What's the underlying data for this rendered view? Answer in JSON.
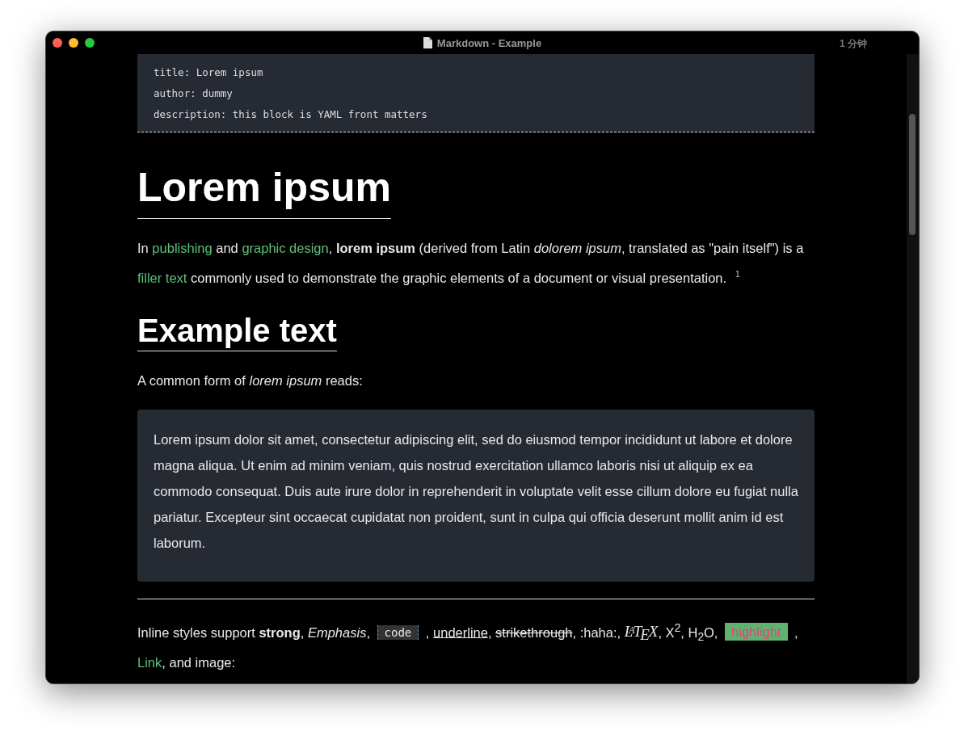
{
  "window": {
    "title": "Markdown - Example",
    "reading_time": "1 分钟"
  },
  "front_matter": [
    "title: Lorem ipsum",
    "author: dummy",
    "description: this block is YAML front matters"
  ],
  "blocks": [
    {
      "kind": "h1",
      "text": "Lorem ipsum"
    },
    {
      "kind": "p",
      "segments": [
        {
          "kind": "plain",
          "text": "In "
        },
        {
          "kind": "link",
          "text": "publishing"
        },
        {
          "kind": "plain",
          "text": " and "
        },
        {
          "kind": "link",
          "text": "graphic design"
        },
        {
          "kind": "plain",
          "text": ", **lorem ipsum** (derived from Latin *dolorem ipsum*, translated as \"pain itself\") is a "
        },
        {
          "kind": "link",
          "text": "filler text"
        },
        {
          "kind": "plain",
          "text": " commonly used to demonstrate the graphic elements of a document or visual presentation. "
        },
        {
          "kind": "footnote",
          "text": "1"
        }
      ]
    },
    {
      "kind": "h2",
      "text": "Example text"
    },
    {
      "kind": "p",
      "segments": [
        {
          "kind": "plain",
          "text": "A common form of *lorem ipsum* reads:"
        }
      ]
    },
    {
      "kind": "quote",
      "text": "Lorem ipsum dolor sit amet, consectetur adipiscing elit, sed do eiusmod tempor incididunt ut labore et dolore magna aliqua. Ut enim ad minim veniam, quis nostrud exercitation ullamco laboris nisi ut aliquip ex ea commodo consequat. Duis aute irure dolor in reprehenderit in voluptate velit esse cillum dolore eu fugiat nulla pariatur. Excepteur sint occaecat cupidatat non proident, sunt in culpa qui officia deserunt mollit anim id est laborum."
    },
    {
      "kind": "hr"
    },
    {
      "kind": "p",
      "segments": [
        {
          "kind": "plain",
          "text": "Inline styles support **strong**, *Emphasis*, "
        },
        {
          "kind": "code",
          "text": "code"
        },
        {
          "kind": "plain",
          "text": " , "
        },
        {
          "kind": "underline",
          "text": "underline"
        },
        {
          "kind": "plain",
          "text": ", "
        },
        {
          "kind": "strike",
          "text": "strikethrough"
        },
        {
          "kind": "plain",
          "text": ", :haha:, "
        },
        {
          "kind": "latex",
          "text": "L$^{A}$T$_{E}$X"
        },
        {
          "kind": "plain",
          "text": ", X$^{2}$, H$_{2}$O, "
        },
        {
          "kind": "highlight",
          "text": "highlight"
        },
        {
          "kind": "plain",
          "text": " , "
        },
        {
          "kind": "link",
          "text": "Link"
        },
        {
          "kind": "plain",
          "text": ", and image:"
        }
      ]
    }
  ]
}
